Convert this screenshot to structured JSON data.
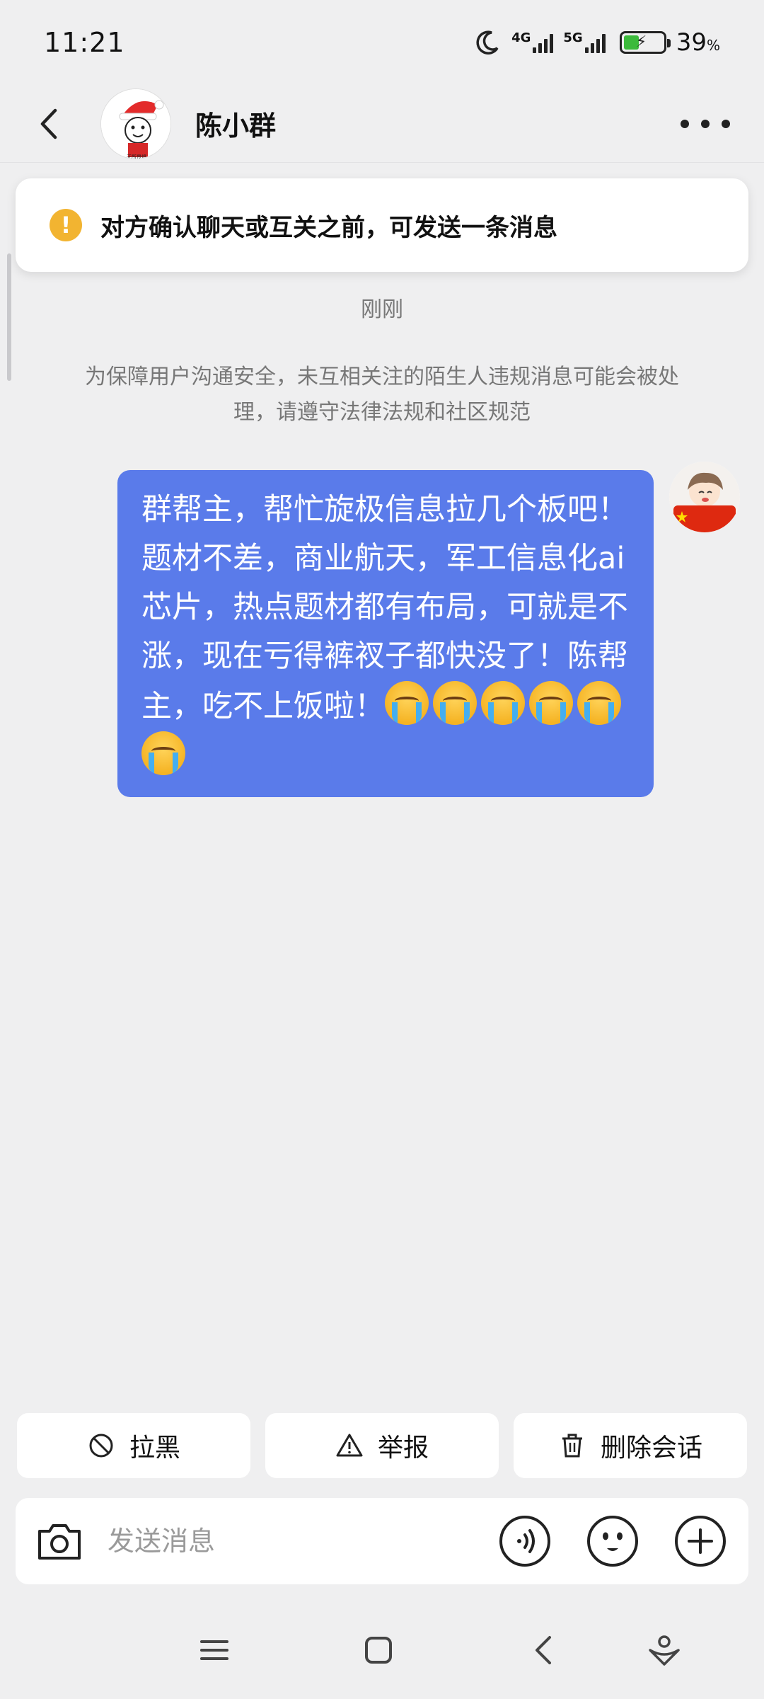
{
  "status_bar": {
    "time": "11:21",
    "net1": "4G",
    "net2": "5G",
    "battery_percent": "39",
    "battery_unit": "%",
    "battery_level": 0.39,
    "battery_color": "#3cba3c"
  },
  "header": {
    "contact_name": "陈小群",
    "avatar_caption": "无所畏惧"
  },
  "notice": {
    "icon": "!",
    "text": "对方确认聊天或互关之前，可发送一条消息",
    "icon_color": "#f2b431"
  },
  "chat": {
    "timestamp": "刚刚",
    "safety_tip": "为保障用户沟通安全，未互相关注的陌生人违规消息可能会被处理，请遵守法律法规和社区规范",
    "message": {
      "text": "群帮主，帮忙旋极信息拉几个板吧！题材不差，商业航天，军工信息化ai芯片，热点题材都有布局，可就是不涨，现在亏得裤衩子都快没了！陈帮主，吃不上饭啦！",
      "emoji": "crying-face",
      "emoji_count": 6,
      "bubble_color": "#5a7bea"
    }
  },
  "actions": {
    "block_label": "拉黑",
    "report_label": "举报",
    "delete_label": "删除会话"
  },
  "input": {
    "placeholder": "发送消息"
  },
  "icons": [
    "back-icon",
    "more-icon",
    "warning-icon",
    "block-icon",
    "report-icon",
    "trash-icon",
    "camera-icon",
    "voice-icon",
    "emoji-icon",
    "plus-icon",
    "menu-icon",
    "home-icon",
    "nav-back-icon",
    "assistant-icon"
  ]
}
